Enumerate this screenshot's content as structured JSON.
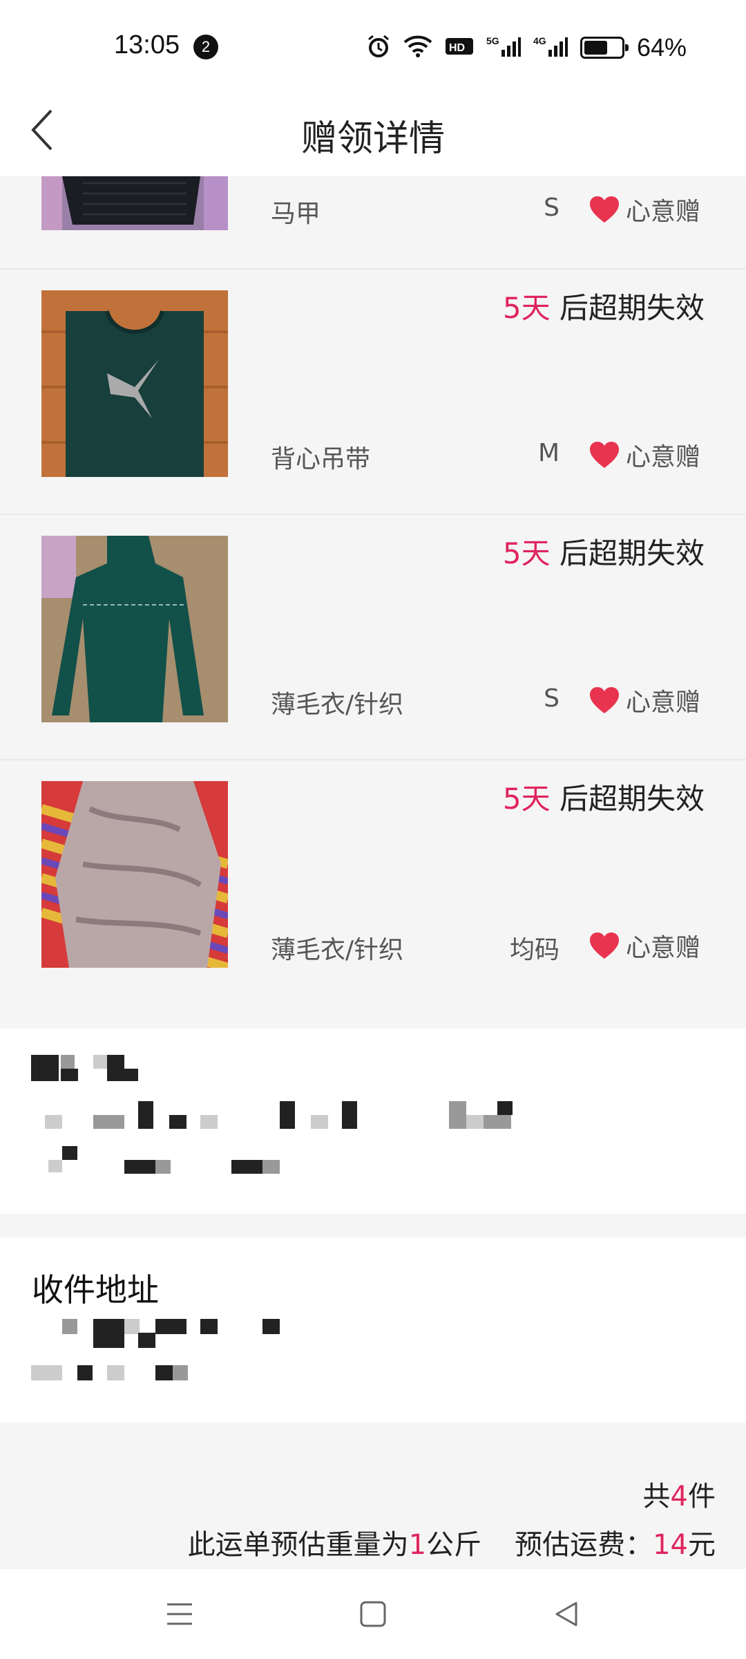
{
  "status_bar": {
    "time": "13:05",
    "notification_count": "2",
    "battery_text": "64%",
    "battery_level": 0.64,
    "icons": [
      "alarm-icon",
      "wifi-icon",
      "hd-icon",
      "5g-signal-icon",
      "4g-signal-icon",
      "battery-icon"
    ]
  },
  "header": {
    "title": "赠领详情",
    "back_icon": "chevron-left-icon"
  },
  "items": [
    {
      "name": "马甲",
      "size": "S",
      "type": "心意赠",
      "expiry_days": "",
      "expiry_suffix": ""
    },
    {
      "name": "背心吊带",
      "size": "M",
      "type": "心意赠",
      "expiry_days": "5天",
      "expiry_suffix": " 后超期失效"
    },
    {
      "name": "薄毛衣/针织",
      "size": "S",
      "type": "心意赠",
      "expiry_days": "5天",
      "expiry_suffix": " 后超期失效"
    },
    {
      "name": "薄毛衣/针织",
      "size": "均码",
      "type": "心意赠",
      "expiry_days": "5天",
      "expiry_suffix": " 后超期失效"
    }
  ],
  "address": {
    "title": "收件地址"
  },
  "summary": {
    "total_prefix": "共",
    "total_count": "4",
    "total_suffix": "件",
    "weight_prefix": "此运单预估重量为",
    "weight_value": "1",
    "weight_unit": "公斤",
    "fee_label": "预估运费：",
    "fee_value": "14",
    "fee_unit": "元"
  },
  "nav": {
    "icons": [
      "menu-icon",
      "home-square-icon",
      "back-triangle-icon"
    ]
  },
  "colors": {
    "accent": "#e0245e",
    "heart": "#e8344f"
  }
}
